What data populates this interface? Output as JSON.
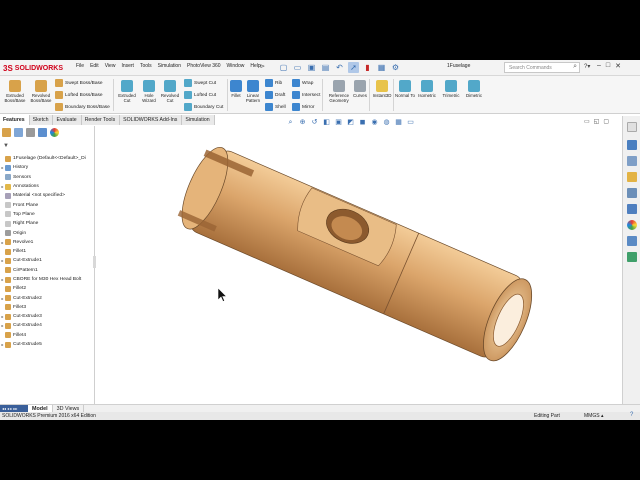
{
  "app": {
    "logo_text": "SOLIDWORKS",
    "logo_glyph": "3S",
    "menus": [
      "File",
      "Edit",
      "View",
      "Insert",
      "Tools",
      "Simulation",
      "PhotoView 360",
      "Window",
      "Help"
    ],
    "menu_pin": "⊳",
    "document_name": "1Fuselage",
    "search_placeholder": "Search Commands",
    "help_dropdown": "?▾",
    "window_controls": [
      "–",
      "□",
      "✕"
    ],
    "quick_access_icons": [
      "new-icon",
      "open-icon",
      "save-icon",
      "print-icon",
      "undo-icon",
      "select-icon",
      "rebuild-icon",
      "file-properties-icon",
      "options-icon"
    ]
  },
  "ribbon": {
    "extruded_boss": "Extruded Boss/Base",
    "revolved_boss": "Revolved Boss/Base",
    "swept_boss": "Swept Boss/Base",
    "lofted_boss": "Lofted Boss/Base",
    "boundary_boss": "Boundary Boss/Base",
    "extruded_cut": "Extruded Cut",
    "hole_wizard": "Hole Wizard",
    "revolved_cut": "Revolved Cut",
    "swept_cut": "Swept Cut",
    "lofted_cut": "Lofted Cut",
    "boundary_cut": "Boundary Cut",
    "fillet": "Fillet",
    "linear_pattern": "Linear Pattern",
    "rib": "Rib",
    "draft": "Draft",
    "shell": "Shell",
    "wrap": "Wrap",
    "intersect": "Intersect",
    "mirror": "Mirror",
    "reference_geometry": "Reference Geometry",
    "curves": "Curves",
    "instant3d": "Instant3D",
    "normal_to": "Normal To",
    "isometric": "Isometric",
    "trimetric": "Trimetric",
    "dimetric": "Dimetric"
  },
  "tabs": [
    "Features",
    "Sketch",
    "Evaluate",
    "Render Tools",
    "SOLIDWORKS Add-Ins",
    "Simulation"
  ],
  "feature_tree": {
    "filter_glyph": "▼",
    "items": [
      {
        "label": "1Fuselage  (Default<<Default>_Di",
        "arrow": "",
        "icon": "part",
        "color": "#d8a24a"
      },
      {
        "label": "History",
        "arrow": "▸",
        "icon": "history",
        "color": "#6a9ad0"
      },
      {
        "label": "Sensors",
        "arrow": "",
        "icon": "sensor",
        "color": "#8aa8c8"
      },
      {
        "label": "Annotations",
        "arrow": "▸",
        "icon": "annotation",
        "color": "#e2b84a"
      },
      {
        "label": "Material <not specified>",
        "arrow": "",
        "icon": "material",
        "color": "#a7a0b8"
      },
      {
        "label": "Front Plane",
        "arrow": "",
        "icon": "plane",
        "color": "#c7c7c7"
      },
      {
        "label": "Top Plane",
        "arrow": "",
        "icon": "plane",
        "color": "#c7c7c7"
      },
      {
        "label": "Right Plane",
        "arrow": "",
        "icon": "plane",
        "color": "#c7c7c7"
      },
      {
        "label": "Origin",
        "arrow": "",
        "icon": "origin",
        "color": "#9c9c9c"
      },
      {
        "label": "Revolve1",
        "arrow": "▸",
        "icon": "revolve",
        "color": "#d8a24a"
      },
      {
        "label": "Fillet1",
        "arrow": "",
        "icon": "fillet",
        "color": "#d8a24a"
      },
      {
        "label": "Cut-Extrude1",
        "arrow": "▸",
        "icon": "cut",
        "color": "#d8a24a"
      },
      {
        "label": "CirPattern1",
        "arrow": "",
        "icon": "pattern",
        "color": "#d8a24a"
      },
      {
        "label": "CBORE for M30 Hex Head Bolt",
        "arrow": "▸",
        "icon": "hole",
        "color": "#d8a24a"
      },
      {
        "label": "Fillet2",
        "arrow": "",
        "icon": "fillet",
        "color": "#d8a24a"
      },
      {
        "label": "Cut-Extrude2",
        "arrow": "▸",
        "icon": "cut",
        "color": "#d8a24a"
      },
      {
        "label": "Fillet3",
        "arrow": "",
        "icon": "fillet",
        "color": "#d8a24a"
      },
      {
        "label": "Cut-Extrude3",
        "arrow": "▸",
        "icon": "cut",
        "color": "#d8a24a"
      },
      {
        "label": "Cut-Extrude4",
        "arrow": "▸",
        "icon": "cut",
        "color": "#d8a24a"
      },
      {
        "label": "Fillet4",
        "arrow": "",
        "icon": "fillet",
        "color": "#d8a24a"
      },
      {
        "label": "Cut-Extrude5",
        "arrow": "▸",
        "icon": "cut",
        "color": "#d8a24a"
      }
    ]
  },
  "bottom_tabs": [
    "Model",
    "3D Views"
  ],
  "bottom_nav": "◂◂ ◂ ▸ ▸▸",
  "status": {
    "product": "SOLIDWORKS Premium 2016 x64 Edition",
    "mode": "Editing Part",
    "units": "MMGS",
    "units_arrow": "▴",
    "help": "?"
  },
  "colors": {
    "brand_red": "#d0021b",
    "wood_light": "#f3cc98",
    "wood_mid": "#dba56b",
    "wood_dark": "#a8703c"
  }
}
